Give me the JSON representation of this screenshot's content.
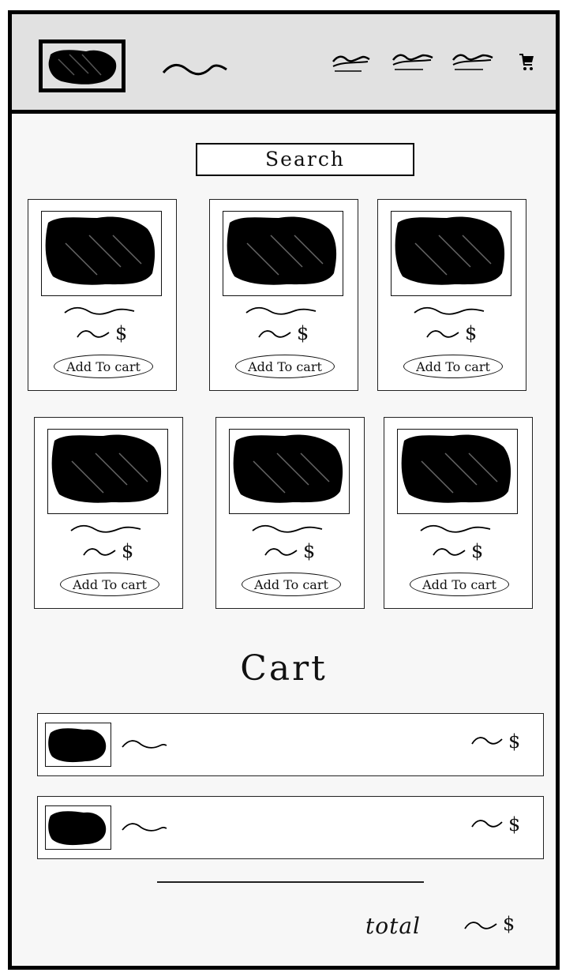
{
  "search": {
    "label": "Search"
  },
  "products": [
    {
      "button_label": "Add To cart",
      "currency": "$"
    },
    {
      "button_label": "Add To cart",
      "currency": "$"
    },
    {
      "button_label": "Add To cart",
      "currency": "$"
    },
    {
      "button_label": "Add To cart",
      "currency": "$"
    },
    {
      "button_label": "Add To cart",
      "currency": "$"
    },
    {
      "button_label": "Add To cart",
      "currency": "$"
    }
  ],
  "cart": {
    "title": "Cart",
    "items": [
      {
        "currency": "$"
      },
      {
        "currency": "$"
      }
    ],
    "total_label": "total",
    "total_currency": "$"
  },
  "icons": {
    "cart": "shopping-cart-icon"
  },
  "colors": {
    "header_bg": "#e1e1e1",
    "page_bg": "#f7f7f7",
    "ink": "#000000"
  }
}
